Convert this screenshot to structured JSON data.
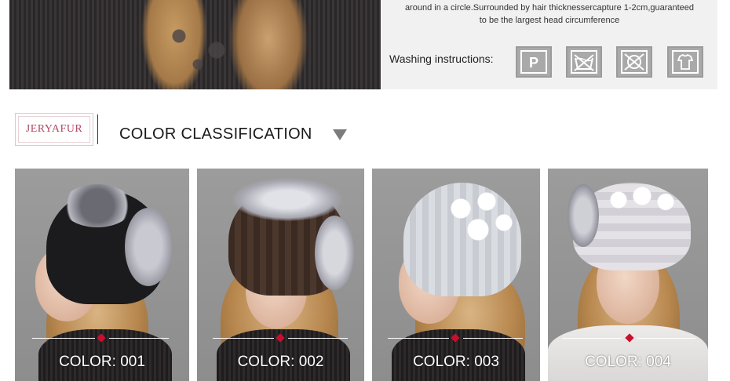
{
  "top": {
    "info_line_1": "around in a circle.Surrounded by hair thicknessercapture 1-2cm,guaranteed",
    "info_line_2": "to be the largest head circumference",
    "washing_label": "Washing instructions:",
    "washing_icons": [
      {
        "name": "dry-clean-p-icon",
        "glyph": "P"
      },
      {
        "name": "do-not-wash-icon",
        "glyph": ""
      },
      {
        "name": "do-not-tumble-dry-icon",
        "glyph": ""
      },
      {
        "name": "hang-dry-icon",
        "glyph": ""
      }
    ]
  },
  "header": {
    "brand": "JERYAFUR",
    "section_title": "COLOR CLASSIFICATION"
  },
  "products": [
    {
      "label": "COLOR: 001",
      "hat_color": "#1b1a1c",
      "fur_color": "#b9b9c2"
    },
    {
      "label": "COLOR: 002",
      "hat_color": "#3a2a22",
      "fur_color": "#c7c7cf"
    },
    {
      "label": "COLOR: 003",
      "hat_color": "#d9dde2",
      "fur_color": "#f4f4f4"
    },
    {
      "label": "COLOR: 004",
      "hat_color": "#e4e2e6",
      "fur_color": "#f4f4f4"
    }
  ],
  "colors": {
    "accent_diamond": "#c8102e",
    "brand_text": "#b24b67",
    "icon_bg": "#a9a9a9"
  }
}
